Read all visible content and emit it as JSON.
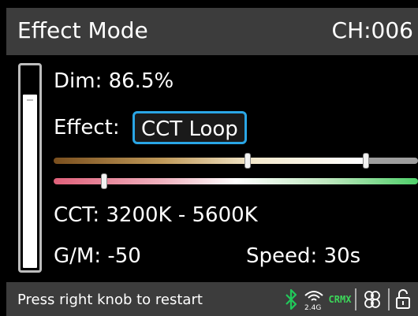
{
  "header": {
    "title": "Effect Mode",
    "channel": "CH:006"
  },
  "dim": {
    "label": "Dim: 86.5%",
    "level_fraction": 0.865
  },
  "effect": {
    "label": "Effect:",
    "value": "CCT Loop"
  },
  "sliders": {
    "cct_range_fraction": [
      0.56,
      0.86
    ],
    "gm_fraction": 0.14
  },
  "readouts": {
    "cct": "CCT: 3200K  -  5600K",
    "gm": "G/M: -50",
    "speed": "Speed: 30s"
  },
  "footer": {
    "hint": "Press right knob to restart",
    "wifi_band": "2.4G",
    "crmx_top": "CR",
    "crmx_bottom": "MX",
    "icons": [
      "bluetooth-icon",
      "wireless-icon",
      "crmx-icon",
      "cloud-sync-icon",
      "unlock-icon"
    ],
    "colors": {
      "bluetooth": "#21c95a",
      "crmx": "#3cd85a",
      "accent": "#2aa6e6"
    }
  }
}
